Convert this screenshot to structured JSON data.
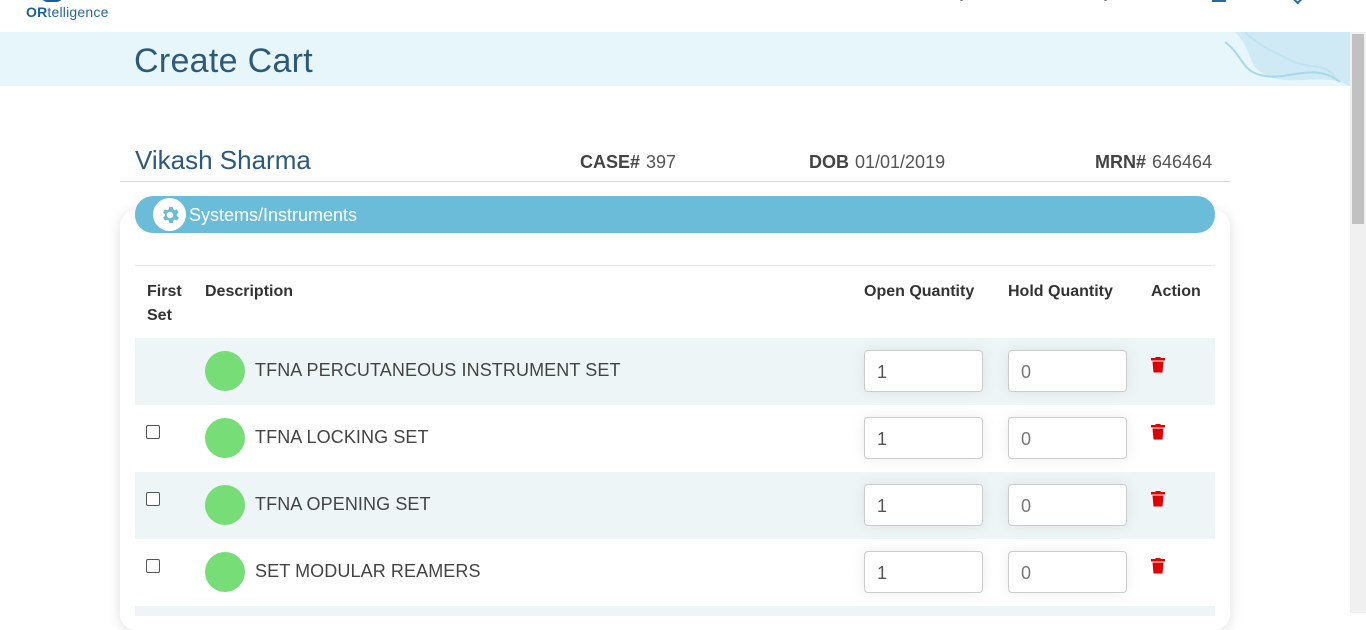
{
  "app": {
    "logo_text_bold": "OR",
    "logo_text": "telligence"
  },
  "page": {
    "title": "Create Cart"
  },
  "patient": {
    "name": "Vikash Sharma",
    "case_label": "CASE#",
    "case_value": "397",
    "dob_label": "DOB",
    "dob_value": "01/01/2019",
    "mrn_label": "MRN#",
    "mrn_value": "646464"
  },
  "section": {
    "label": "Systems/Instruments",
    "icon": "gear-icon"
  },
  "table": {
    "headers": {
      "first_set": "First Set",
      "description": "Description",
      "open_quantity": "Open Quantity",
      "hold_quantity": "Hold Quantity",
      "action": "Action"
    },
    "rows": [
      {
        "description": "TFNA PERCUTANEOUS INSTRUMENT SET",
        "open": "1",
        "hold": "0",
        "has_checkbox": false
      },
      {
        "description": "TFNA LOCKING SET",
        "open": "1",
        "hold": "0",
        "has_checkbox": true
      },
      {
        "description": "TFNA OPENING SET",
        "open": "1",
        "hold": "0",
        "has_checkbox": true
      },
      {
        "description": "SET MODULAR REAMERS",
        "open": "1",
        "hold": "0",
        "has_checkbox": true
      }
    ]
  },
  "colors": {
    "accent_bar": "#6bbcd9",
    "status_dot": "#77dd77",
    "trash": "#e00000",
    "banner": "#e6f6fb",
    "title": "#2d5a78"
  }
}
